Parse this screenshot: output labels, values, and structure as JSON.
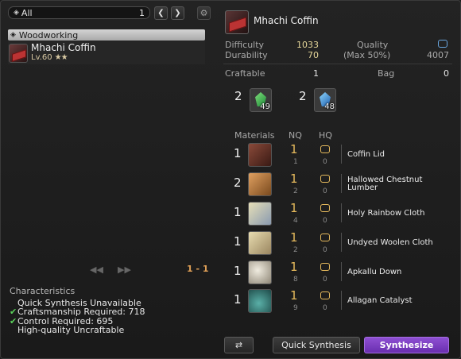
{
  "filter": {
    "label": "All",
    "page": "1"
  },
  "category": {
    "label": "Woodworking"
  },
  "recipe_list": [
    {
      "name": "Mhachi Coffin",
      "level": "Lv.60",
      "stars": "★★"
    }
  ],
  "pager": {
    "prev": "◀◀",
    "next": "▶▶",
    "indicator": "1 - 1"
  },
  "characteristics": {
    "title": "Characteristics",
    "lines": [
      {
        "text": "Quick Synthesis Unavailable",
        "met": false
      },
      {
        "text": "Craftsmanship Required: 718",
        "met": true
      },
      {
        "text": "Control Required: 695",
        "met": true
      },
      {
        "text": "High-quality Uncraftable",
        "met": false
      }
    ]
  },
  "item": {
    "name": "Mhachi Coffin",
    "difficulty_label": "Difficulty",
    "difficulty": "1033",
    "durability_label": "Durability",
    "durability": "70",
    "quality_label": "Quality",
    "quality_max": "(Max 50%)",
    "quality_value": "4007",
    "craftable_label": "Craftable",
    "craftable": "1",
    "bag_label": "Bag",
    "bag": "0"
  },
  "crystals": [
    {
      "mult": "2",
      "count": "49",
      "color_a": "#7fe07a",
      "color_b": "#1e8a3a",
      "icon": "wind-crystal-icon"
    },
    {
      "mult": "2",
      "count": "48",
      "color_a": "#8fd8ff",
      "color_b": "#1e5fb0",
      "icon": "water-crystal-icon"
    }
  ],
  "materials_header": {
    "materials": "Materials",
    "nq": "NQ",
    "hq": "HQ"
  },
  "materials": [
    {
      "qty": "1",
      "nq": "1",
      "nq_have": "1",
      "hq_have": "0",
      "name": "Coffin Lid",
      "icon": "coffin-lid-icon",
      "c1": "#8a4a3a",
      "c2": "#3a1a14"
    },
    {
      "qty": "2",
      "nq": "1",
      "nq_have": "2",
      "hq_have": "0",
      "name": "Hallowed Chestnut Lumber",
      "icon": "lumber-icon",
      "c1": "#e0a060",
      "c2": "#7a4a1e"
    },
    {
      "qty": "1",
      "nq": "1",
      "nq_have": "4",
      "hq_have": "0",
      "name": "Holy Rainbow Cloth",
      "icon": "cloth-icon",
      "c1": "#e6dfb8",
      "c2": "#8a9ab0"
    },
    {
      "qty": "1",
      "nq": "1",
      "nq_have": "2",
      "hq_have": "0",
      "name": "Undyed Woolen Cloth",
      "icon": "woolen-cloth-icon",
      "c1": "#e8dcb0",
      "c2": "#9a8660"
    },
    {
      "qty": "1",
      "nq": "1",
      "nq_have": "8",
      "hq_have": "0",
      "name": "Apkallu Down",
      "icon": "down-feather-icon",
      "c1": "#f0ece0",
      "c2": "#8e8676"
    },
    {
      "qty": "1",
      "nq": "1",
      "nq_have": "9",
      "hq_have": "0",
      "name": "Allagan Catalyst",
      "icon": "catalyst-icon",
      "c1": "#5ab0a8",
      "c2": "#1e4a48"
    }
  ],
  "buttons": {
    "recipe_tree": "⇄",
    "quick_synthesis": "Quick Synthesis",
    "synthesize": "Synthesize"
  },
  "colors": {
    "accent_purple": "#7b3fc4",
    "nq_gold": "#e5b95c",
    "check_green": "#5ad05a"
  }
}
